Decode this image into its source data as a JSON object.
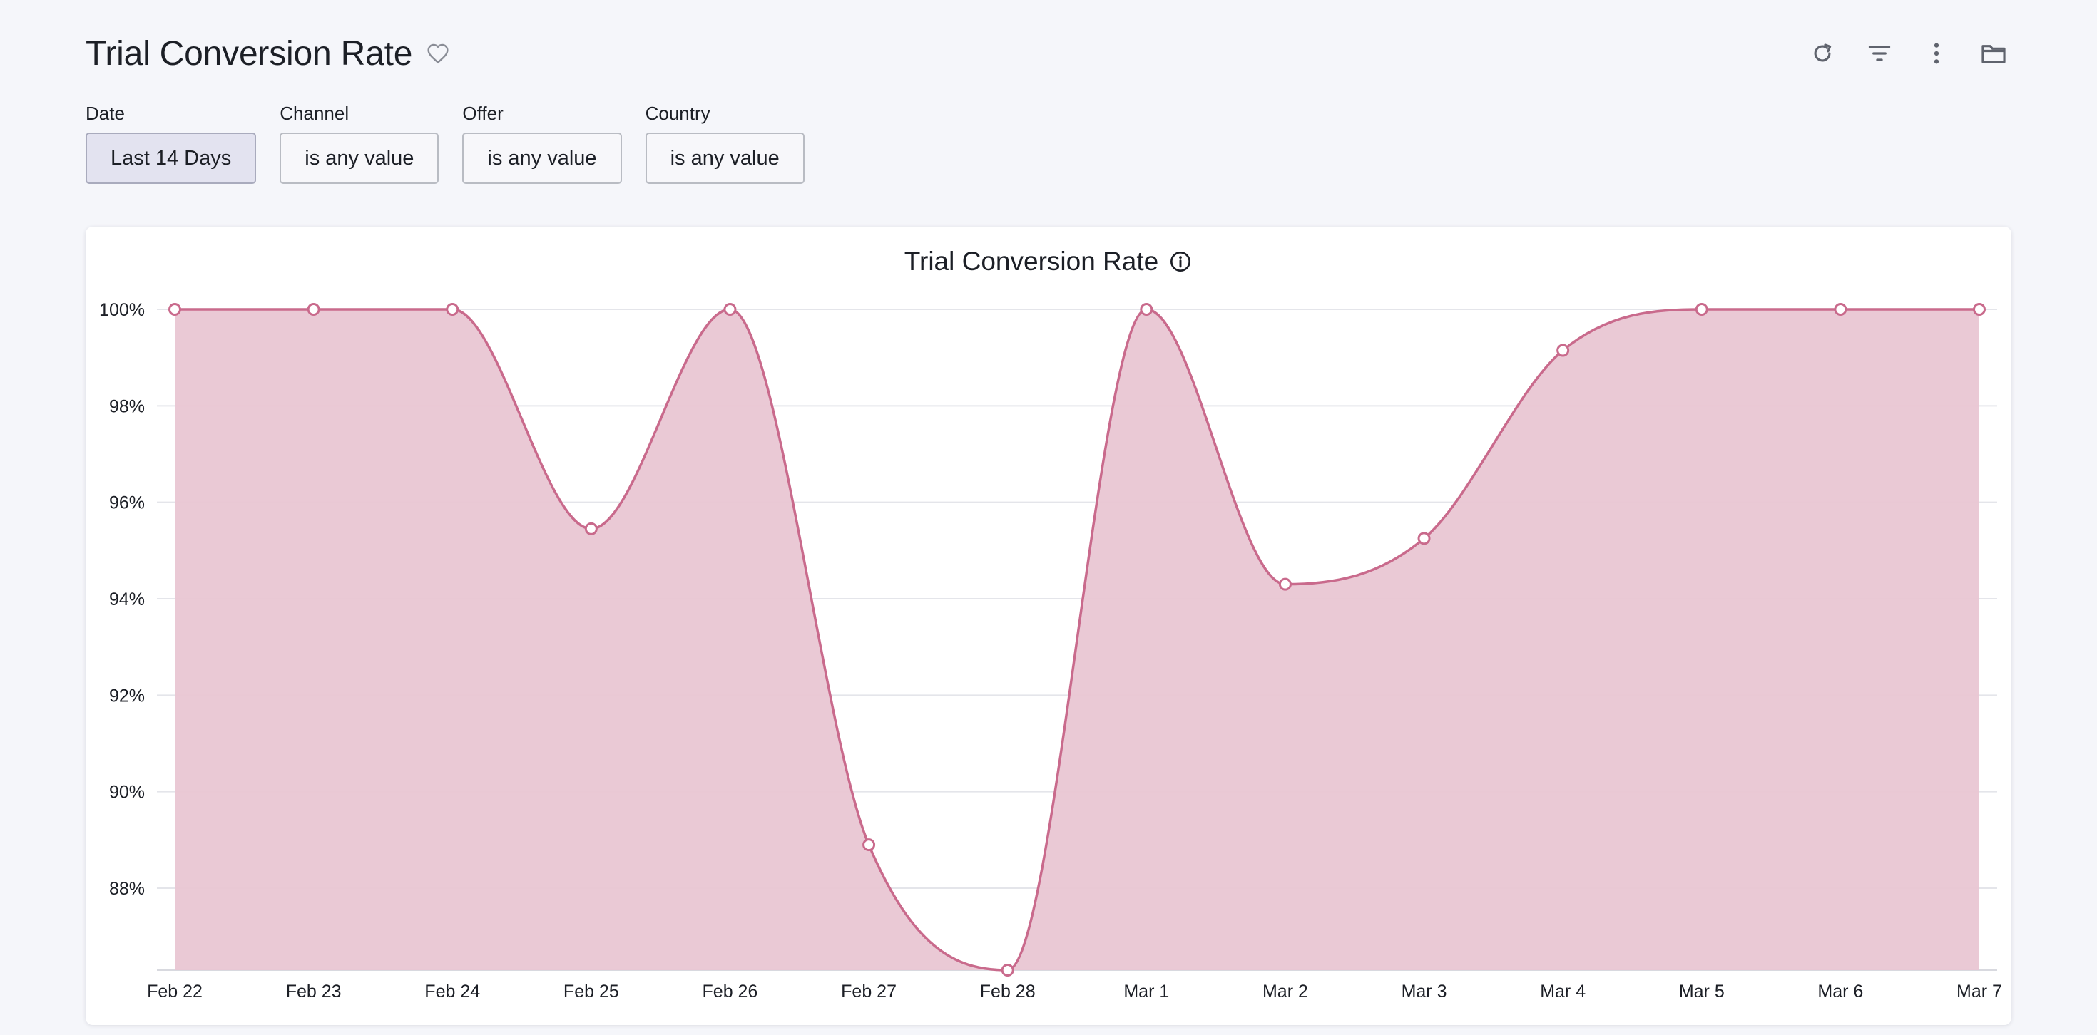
{
  "header": {
    "title": "Trial Conversion Rate",
    "icons": [
      "heart-icon",
      "refresh-icon",
      "filter-icon",
      "more-vertical-icon",
      "folder-icon"
    ]
  },
  "filters": [
    {
      "label": "Date",
      "value": "Last 14 Days"
    },
    {
      "label": "Channel",
      "value": "is any value"
    },
    {
      "label": "Offer",
      "value": "is any value"
    },
    {
      "label": "Country",
      "value": "is any value"
    }
  ],
  "colors": {
    "line": "#c96a8c",
    "fill": "#e9c6d3",
    "active_filter": "#e3e3f0"
  },
  "chart_data": {
    "type": "area",
    "title": "Trial Conversion Rate",
    "xlabel": "",
    "ylabel": "",
    "categories": [
      "Feb 22",
      "Feb 23",
      "Feb 24",
      "Feb 25",
      "Feb 26",
      "Feb 27",
      "Feb 28",
      "Mar 1",
      "Mar 2",
      "Mar 3",
      "Mar 4",
      "Mar 5",
      "Mar 6",
      "Mar 7"
    ],
    "values": [
      100,
      100,
      100,
      95.45,
      100,
      88.9,
      86.3,
      100,
      94.3,
      95.25,
      99.15,
      100,
      100,
      100
    ],
    "yticks": [
      88,
      90,
      92,
      94,
      96,
      98,
      100
    ],
    "ytick_labels": [
      "88%",
      "90%",
      "92%",
      "94%",
      "96%",
      "98%",
      "100%"
    ],
    "ylim": [
      86.3,
      100
    ],
    "grid": true,
    "legend": "none"
  }
}
